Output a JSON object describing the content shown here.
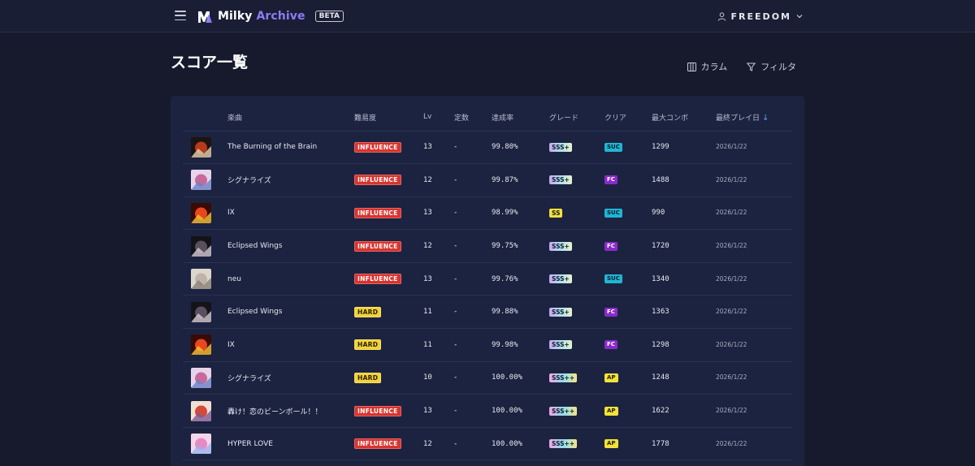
{
  "header": {
    "logo_main": "Milky",
    "logo_accent": "Archive",
    "beta": "BETA",
    "user_name": "FREEDOM"
  },
  "page": {
    "title": "スコア一覧",
    "columns_button": "カラム",
    "filter_button": "フィルタ"
  },
  "table": {
    "headers": [
      "楽曲",
      "難易度",
      "Lv",
      "定数",
      "達成率",
      "グレード",
      "クリア",
      "最大コンボ",
      "最終プレイ日"
    ],
    "sort_indicator": "↓",
    "rows": [
      {
        "title": "The Burning of the Brain",
        "difficulty": "INFLUENCE",
        "lv": "13",
        "const": "-",
        "rate": "99.80%",
        "grade": "SSS+",
        "clear": "SUC",
        "combo": "1299",
        "date": "2026/1/22"
      },
      {
        "title": "シグナライズ",
        "difficulty": "INFLUENCE",
        "lv": "12",
        "const": "-",
        "rate": "99.87%",
        "grade": "SSS+",
        "clear": "FC",
        "combo": "1488",
        "date": "2026/1/22"
      },
      {
        "title": "IX",
        "difficulty": "INFLUENCE",
        "lv": "13",
        "const": "-",
        "rate": "98.99%",
        "grade": "SS",
        "clear": "SUC",
        "combo": "990",
        "date": "2026/1/22"
      },
      {
        "title": "Eclipsed Wings",
        "difficulty": "INFLUENCE",
        "lv": "12",
        "const": "-",
        "rate": "99.75%",
        "grade": "SSS+",
        "clear": "FC",
        "combo": "1720",
        "date": "2026/1/22"
      },
      {
        "title": "neu",
        "difficulty": "INFLUENCE",
        "lv": "13",
        "const": "-",
        "rate": "99.76%",
        "grade": "SSS+",
        "clear": "SUC",
        "combo": "1340",
        "date": "2026/1/22"
      },
      {
        "title": "Eclipsed Wings",
        "difficulty": "HARD",
        "lv": "11",
        "const": "-",
        "rate": "99.88%",
        "grade": "SSS+",
        "clear": "FC",
        "combo": "1363",
        "date": "2026/1/22"
      },
      {
        "title": "IX",
        "difficulty": "HARD",
        "lv": "11",
        "const": "-",
        "rate": "99.98%",
        "grade": "SSS+",
        "clear": "FC",
        "combo": "1298",
        "date": "2026/1/22"
      },
      {
        "title": "シグナライズ",
        "difficulty": "HARD",
        "lv": "10",
        "const": "-",
        "rate": "100.00%",
        "grade": "SSS++",
        "clear": "AP",
        "combo": "1248",
        "date": "2026/1/22"
      },
      {
        "title": "轟け！恋のビーンボール！！",
        "difficulty": "INFLUENCE",
        "lv": "13",
        "const": "-",
        "rate": "100.00%",
        "grade": "SSS++",
        "clear": "AP",
        "combo": "1622",
        "date": "2026/1/22"
      },
      {
        "title": "HYPER LOVE",
        "difficulty": "INFLUENCE",
        "lv": "12",
        "const": "-",
        "rate": "100.00%",
        "grade": "SSS++",
        "clear": "AP",
        "combo": "1778",
        "date": "2026/1/22"
      }
    ]
  },
  "colors": {
    "background": "#171a2c",
    "header": "#1a1e34",
    "card": "#1c2340",
    "accent": "#8b7cf6",
    "influence": "#d9342f",
    "hard": "#f2d23a",
    "suc": "#22b4d4",
    "fc": "#8a2bc9",
    "ap": "#f2e23a"
  },
  "jackets": [
    [
      "#1b1412",
      "#b83a1c",
      "#e8d2b0"
    ],
    [
      "#e6d4ea",
      "#c76a9a",
      "#6a82c8"
    ],
    [
      "#3a0a04",
      "#e8481c",
      "#f7c43a"
    ],
    [
      "#151317",
      "#5a4f5f",
      "#d6ccd8"
    ],
    [
      "#ddd6cf",
      "#bfb3aa",
      "#8a7f78"
    ],
    [
      "#151317",
      "#5a4f5f",
      "#d6ccd8"
    ],
    [
      "#3a0a04",
      "#e8481c",
      "#f7c43a"
    ],
    [
      "#e6d4ea",
      "#c76a9a",
      "#6a82c8"
    ],
    [
      "#f2e0d2",
      "#d24a3a",
      "#7a5a9a"
    ],
    [
      "#f4d6ea",
      "#e68ac4",
      "#9ab4f0"
    ]
  ]
}
